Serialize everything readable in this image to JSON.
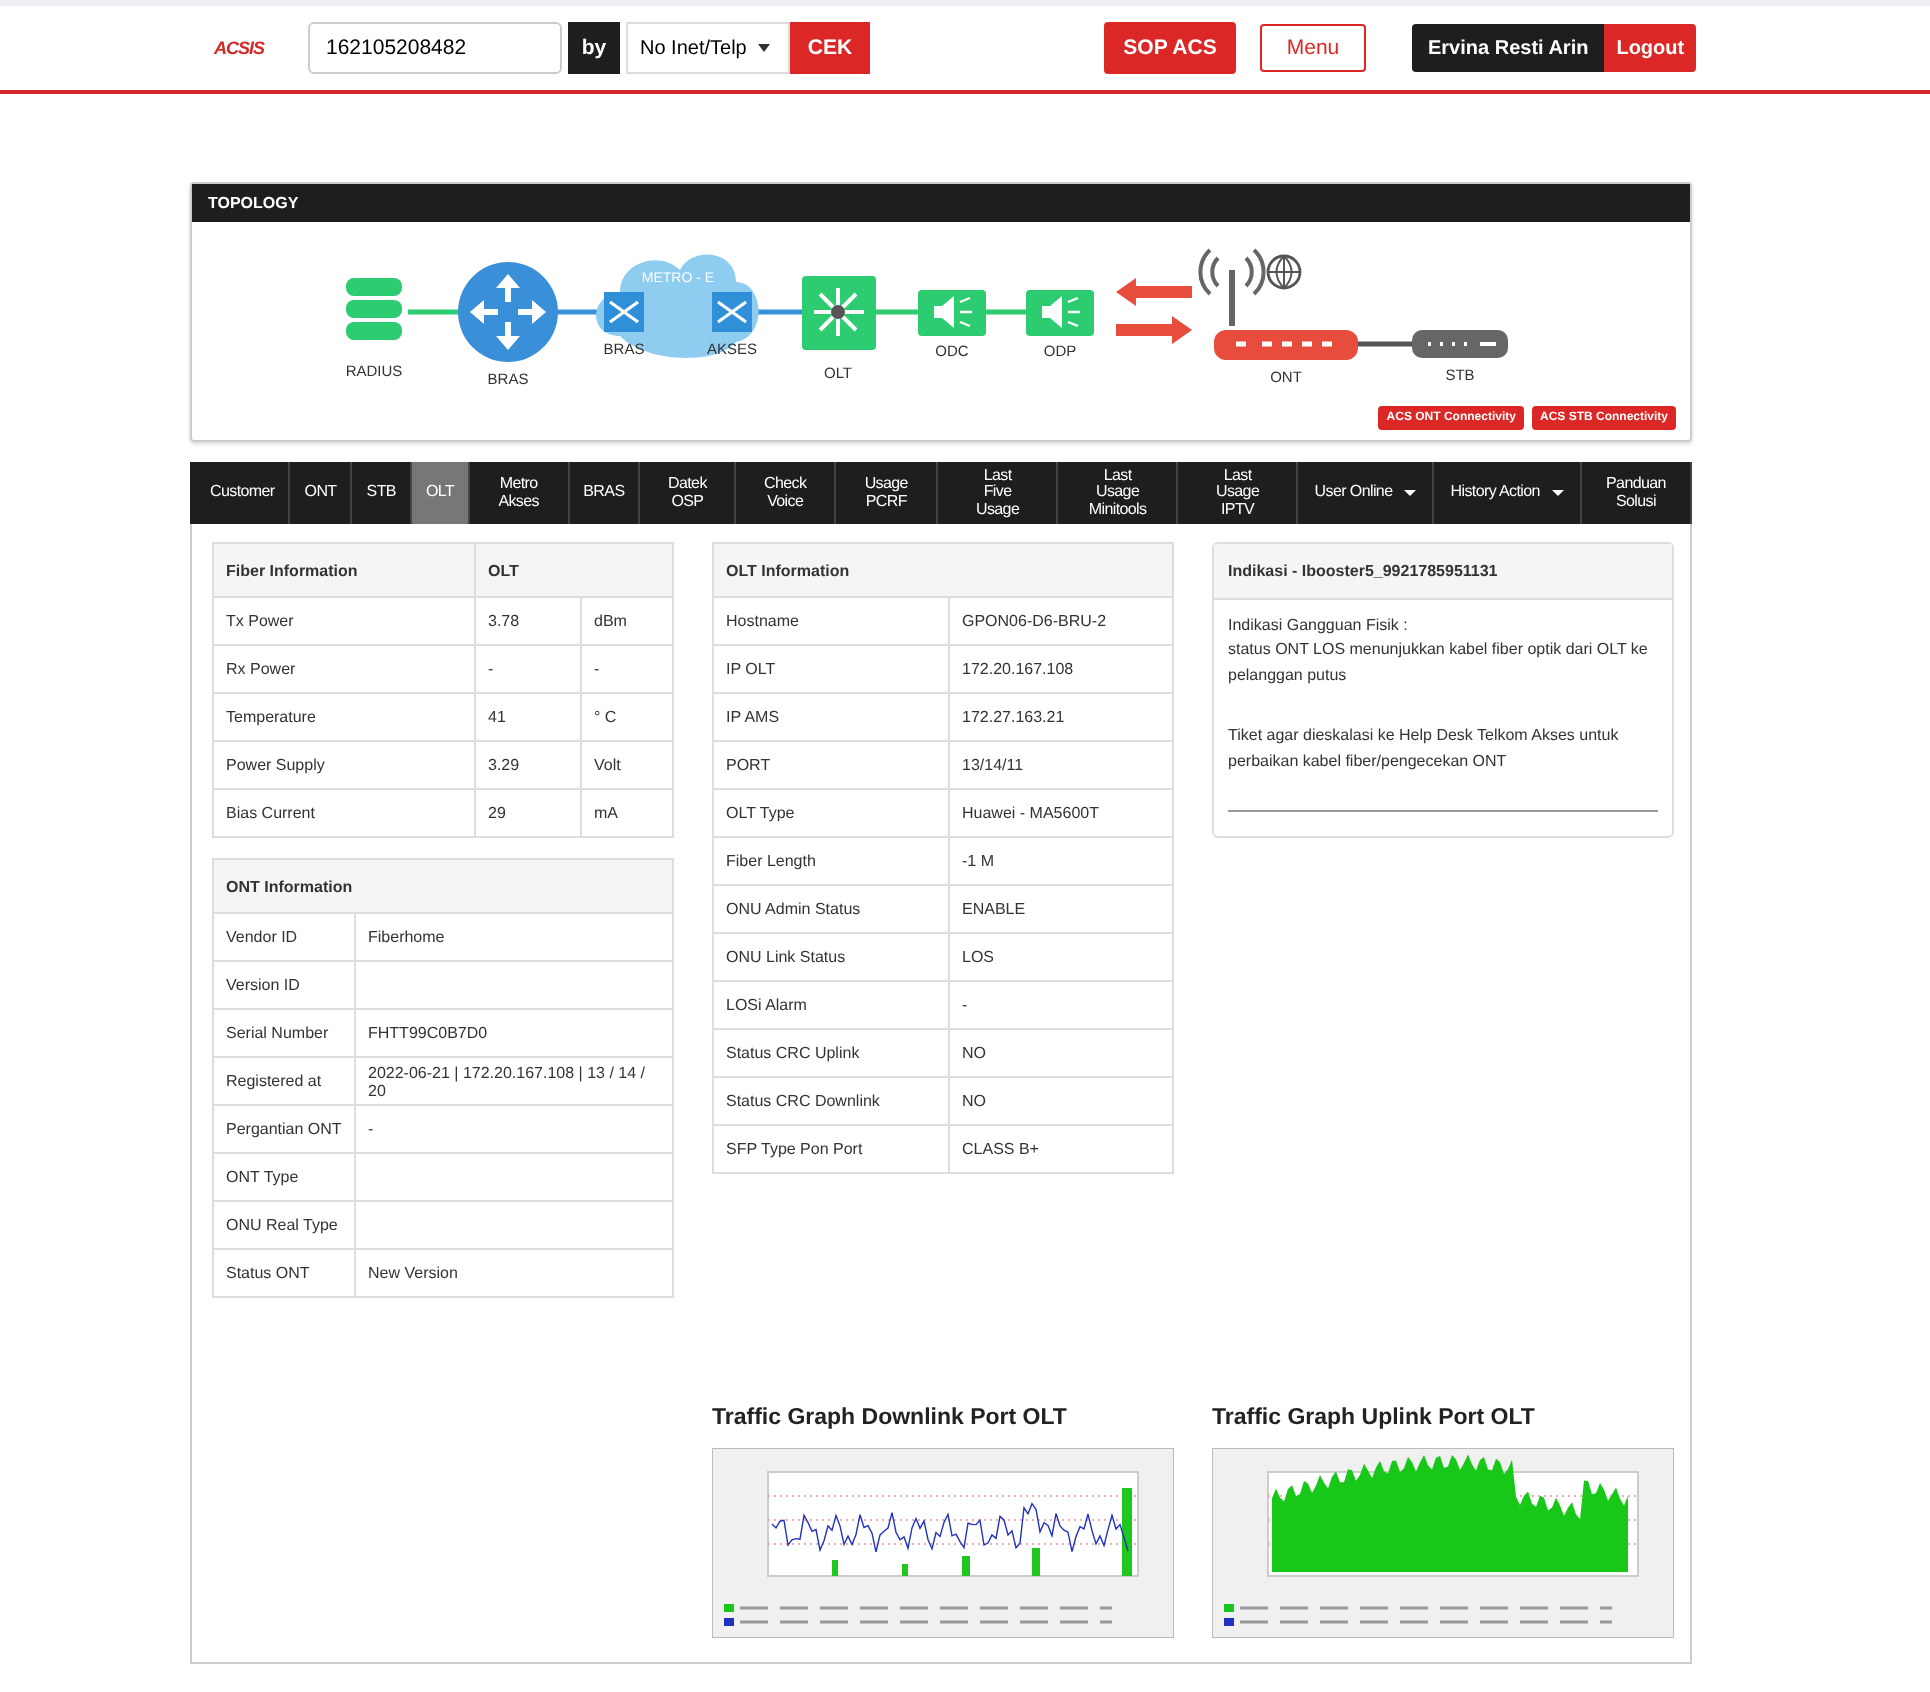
{
  "header": {
    "logo": "ACSIS",
    "search_value": "162105208482",
    "by_label": "by",
    "search_type": "No Inet/Telp",
    "check_button": "CEK",
    "sop_button": "SOP ACS",
    "menu_button": "Menu",
    "user_name": "Ervina Resti Arin",
    "logout_button": "Logout"
  },
  "topology": {
    "title": "TOPOLOGY",
    "nodes": [
      {
        "kind": "database",
        "label": "RADIUS"
      },
      {
        "kind": "router",
        "label": "BRAS"
      },
      {
        "kind": "metro",
        "label": "METRO - E",
        "left_label": "BRAS",
        "right_label": "AKSES"
      },
      {
        "kind": "olt",
        "label": "OLT"
      },
      {
        "kind": "splitter",
        "label": "ODC"
      },
      {
        "kind": "splitter",
        "label": "ODP"
      },
      {
        "kind": "ont",
        "label": "ONT"
      },
      {
        "kind": "stb",
        "label": "STB"
      }
    ],
    "buttons": [
      "ACS ONT Connectivity",
      "ACS STB Connectivity"
    ]
  },
  "tabs": [
    {
      "label": "Customer",
      "kind": "plain",
      "selected": false
    },
    {
      "label": "ONT",
      "kind": "plain",
      "selected": false
    },
    {
      "label": "STB",
      "kind": "plain",
      "selected": false
    },
    {
      "label": "OLT",
      "kind": "plain",
      "selected": true
    },
    {
      "label": "Metro Akses",
      "kind": "plain",
      "selected": false
    },
    {
      "label": "BRAS",
      "kind": "plain",
      "selected": false
    },
    {
      "label": "Datek OSP",
      "kind": "plain",
      "selected": false
    },
    {
      "label": "Check Voice",
      "kind": "plain",
      "selected": false
    },
    {
      "label": "Usage PCRF",
      "kind": "plain",
      "selected": false
    },
    {
      "label": "Last Five Usage",
      "kind": "plain",
      "selected": false
    },
    {
      "label": "Last Usage Minitools",
      "kind": "plain",
      "selected": false
    },
    {
      "label": "Last Usage IPTV",
      "kind": "plain",
      "selected": false
    },
    {
      "label": "User Online",
      "kind": "dropdown",
      "selected": false
    },
    {
      "label": "History Action",
      "kind": "dropdown",
      "selected": false
    },
    {
      "label": "Panduan Solusi",
      "kind": "plain",
      "selected": false
    }
  ],
  "fiber_information": {
    "title": "Fiber Information",
    "column": "OLT",
    "rows": [
      {
        "label": "Tx Power",
        "value": "3.78",
        "unit": "dBm"
      },
      {
        "label": "Rx Power",
        "value": "-",
        "unit": "-"
      },
      {
        "label": "Temperature",
        "value": "41",
        "unit": "° C"
      },
      {
        "label": "Power Supply",
        "value": "3.29",
        "unit": "Volt"
      },
      {
        "label": "Bias Current",
        "value": "29",
        "unit": "mA"
      }
    ]
  },
  "ont_information": {
    "title": "ONT Information",
    "rows": [
      {
        "label": "Vendor ID",
        "value": "Fiberhome"
      },
      {
        "label": "Version ID"
      },
      {
        "label": "Serial Number",
        "value": "FHTT99C0B7D0"
      },
      {
        "label": "Registered at",
        "value": "2022-06-21 | 172.20.167.108 | 13 / 14 / 20"
      },
      {
        "label": "Pergantian ONT",
        "value": "-"
      },
      {
        "label": "ONT Type"
      },
      {
        "label": "ONU Real Type"
      },
      {
        "label": "Status ONT",
        "value": "New Version"
      }
    ]
  },
  "olt_information": {
    "title": "OLT Information",
    "rows": [
      {
        "label": "Hostname",
        "value": "GPON06-D6-BRU-2"
      },
      {
        "label": "IP OLT",
        "value": "172.20.167.108"
      },
      {
        "label": "IP AMS",
        "value": "172.27.163.21"
      },
      {
        "label": "PORT",
        "value": "13/14/11"
      },
      {
        "label": "OLT Type",
        "value": "Huawei - MA5600T"
      },
      {
        "label": "Fiber Length",
        "value": "-1 M"
      },
      {
        "label": "ONU Admin Status",
        "value": "ENABLE"
      },
      {
        "label": "ONU Link Status",
        "value": "LOS"
      },
      {
        "label": "LOSi Alarm",
        "value": "-"
      },
      {
        "label": "Status CRC Uplink",
        "value": "NO"
      },
      {
        "label": "Status CRC Downlink",
        "value": "NO"
      },
      {
        "label": "SFP Type Pon Port",
        "value": "CLASS B+"
      }
    ]
  },
  "indication": {
    "title": "Indikasi - Ibooster5_9921785951131",
    "paragraphs": [
      [
        "Indikasi Gangguan Fisik :",
        "status ONT LOS menunjukkan kabel fiber optik dari OLT ke pelanggan putus"
      ],
      [
        "Tiket agar dieskalasi ke Help Desk Telkom Akses untuk perbaikan kabel fiber/pengecekan ONT"
      ]
    ]
  },
  "graphs": [
    {
      "title": "Traffic Graph Downlink Port OLT",
      "kind": "downlink"
    },
    {
      "title": "Traffic Graph Uplink Port OLT",
      "kind": "uplink"
    }
  ]
}
